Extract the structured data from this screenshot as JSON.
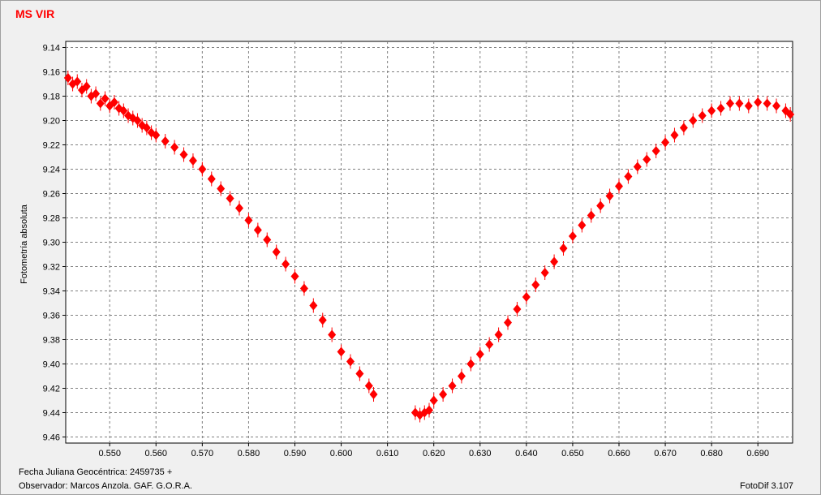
{
  "chart_data": {
    "type": "scatter",
    "title": "MS VIR",
    "ylabel": "Fotometría absoluta",
    "xlabel": "",
    "xlim": [
      0.5405,
      0.6975
    ],
    "ylim": [
      9.465,
      9.135
    ],
    "y_inverted": true,
    "grid": true,
    "marker": "diamond",
    "x_ticks": [
      "0.550",
      "0.560",
      "0.570",
      "0.580",
      "0.590",
      "0.600",
      "0.610",
      "0.620",
      "0.630",
      "0.640",
      "0.650",
      "0.660",
      "0.670",
      "0.680",
      "0.690"
    ],
    "y_ticks": [
      "9.14",
      "9.16",
      "9.18",
      "9.20",
      "9.22",
      "9.24",
      "9.26",
      "9.28",
      "9.30",
      "9.32",
      "9.34",
      "9.36",
      "9.38",
      "9.40",
      "9.42",
      "9.44",
      "9.46"
    ],
    "series": [
      {
        "color": "#ff0000",
        "points": [
          [
            0.541,
            9.165
          ],
          [
            0.542,
            9.17
          ],
          [
            0.543,
            9.168
          ],
          [
            0.544,
            9.175
          ],
          [
            0.545,
            9.172
          ],
          [
            0.546,
            9.18
          ],
          [
            0.547,
            9.178
          ],
          [
            0.548,
            9.186
          ],
          [
            0.549,
            9.182
          ],
          [
            0.55,
            9.188
          ],
          [
            0.551,
            9.185
          ],
          [
            0.552,
            9.19
          ],
          [
            0.553,
            9.192
          ],
          [
            0.554,
            9.196
          ],
          [
            0.555,
            9.198
          ],
          [
            0.556,
            9.2
          ],
          [
            0.557,
            9.204
          ],
          [
            0.558,
            9.206
          ],
          [
            0.559,
            9.21
          ],
          [
            0.56,
            9.212
          ],
          [
            0.562,
            9.217
          ],
          [
            0.564,
            9.222
          ],
          [
            0.566,
            9.228
          ],
          [
            0.568,
            9.233
          ],
          [
            0.57,
            9.24
          ],
          [
            0.572,
            9.248
          ],
          [
            0.574,
            9.256
          ],
          [
            0.576,
            9.264
          ],
          [
            0.578,
            9.272
          ],
          [
            0.58,
            9.282
          ],
          [
            0.582,
            9.29
          ],
          [
            0.584,
            9.298
          ],
          [
            0.586,
            9.308
          ],
          [
            0.588,
            9.318
          ],
          [
            0.59,
            9.328
          ],
          [
            0.592,
            9.338
          ],
          [
            0.594,
            9.352
          ],
          [
            0.596,
            9.364
          ],
          [
            0.598,
            9.376
          ],
          [
            0.6,
            9.39
          ],
          [
            0.602,
            9.398
          ],
          [
            0.604,
            9.408
          ],
          [
            0.606,
            9.418
          ],
          [
            0.607,
            9.425
          ],
          [
            0.616,
            9.44
          ],
          [
            0.617,
            9.442
          ],
          [
            0.618,
            9.44
          ],
          [
            0.619,
            9.438
          ],
          [
            0.62,
            9.43
          ],
          [
            0.622,
            9.425
          ],
          [
            0.624,
            9.418
          ],
          [
            0.626,
            9.41
          ],
          [
            0.628,
            9.4
          ],
          [
            0.63,
            9.392
          ],
          [
            0.632,
            9.384
          ],
          [
            0.634,
            9.376
          ],
          [
            0.636,
            9.366
          ],
          [
            0.638,
            9.355
          ],
          [
            0.64,
            9.345
          ],
          [
            0.642,
            9.335
          ],
          [
            0.644,
            9.325
          ],
          [
            0.646,
            9.316
          ],
          [
            0.648,
            9.305
          ],
          [
            0.65,
            9.295
          ],
          [
            0.652,
            9.286
          ],
          [
            0.654,
            9.278
          ],
          [
            0.656,
            9.27
          ],
          [
            0.658,
            9.262
          ],
          [
            0.66,
            9.254
          ],
          [
            0.662,
            9.246
          ],
          [
            0.664,
            9.238
          ],
          [
            0.666,
            9.232
          ],
          [
            0.668,
            9.225
          ],
          [
            0.67,
            9.218
          ],
          [
            0.672,
            9.212
          ],
          [
            0.674,
            9.206
          ],
          [
            0.676,
            9.2
          ],
          [
            0.678,
            9.196
          ],
          [
            0.68,
            9.192
          ],
          [
            0.682,
            9.19
          ],
          [
            0.684,
            9.186
          ],
          [
            0.686,
            9.186
          ],
          [
            0.688,
            9.188
          ],
          [
            0.69,
            9.185
          ],
          [
            0.692,
            9.186
          ],
          [
            0.694,
            9.188
          ],
          [
            0.696,
            9.192
          ],
          [
            0.697,
            9.195
          ]
        ]
      }
    ]
  },
  "footer": {
    "date_label": "Fecha Juliana Geocéntrica: 2459735 +",
    "observer_label": "Observador:  Marcos Anzola. GAF. G.O.R.A.",
    "software": "FotoDif 3.107"
  }
}
